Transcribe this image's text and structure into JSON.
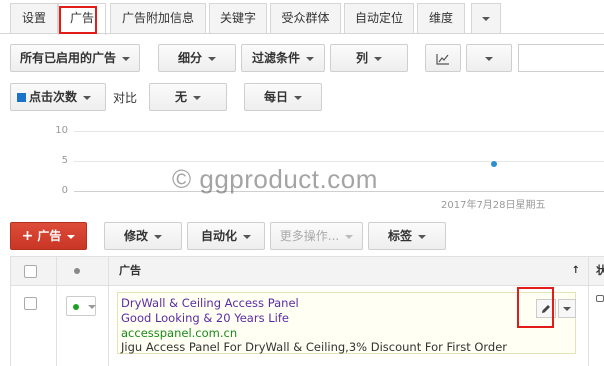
{
  "tabs": [
    {
      "label": "设置"
    },
    {
      "label": "广告"
    },
    {
      "label": "广告附加信息"
    },
    {
      "label": "关键字"
    },
    {
      "label": "受众群体"
    },
    {
      "label": "自动定位"
    },
    {
      "label": "维度"
    }
  ],
  "active_tab": "广告",
  "toolbar": {
    "filter_ads": "所有已启用的广告",
    "segment": "细分",
    "filter": "过滤条件",
    "columns": "列"
  },
  "chart_controls": {
    "metric": "点击次数",
    "metric_color": "#1a73c8",
    "compare_label": "对比",
    "compare_value": "无",
    "period": "每日"
  },
  "chart_data": {
    "type": "scatter",
    "y_ticks": [
      "10",
      "5",
      "0"
    ],
    "ylim": [
      0,
      10
    ],
    "points": [
      {
        "x": "2017年7月28日星期五",
        "y": 4.5
      }
    ],
    "x_label_shown": "2017年7月28日星期五",
    "point_color": "#2b8fcf"
  },
  "watermark": "© ggproduct.com",
  "actions": {
    "add_ad": "广告",
    "edit": "修改",
    "automate": "自动化",
    "more": "更多操作...",
    "labels": "标签"
  },
  "table": {
    "header_ad": "广告",
    "header_partial": "状"
  },
  "ad": {
    "headline1": "DryWall & Ceiling Access Panel",
    "headline2": "Good Looking & 20 Years Life",
    "display_url": "accesspanel.com.cn",
    "description": "Jigu Access Panel For DryWall & Ceiling,3% Discount For First Order",
    "link_color": "#5b2ca8",
    "url_color": "#1a8a1a",
    "status_color": "#20a020"
  },
  "highlight_color": "#e21b1b"
}
